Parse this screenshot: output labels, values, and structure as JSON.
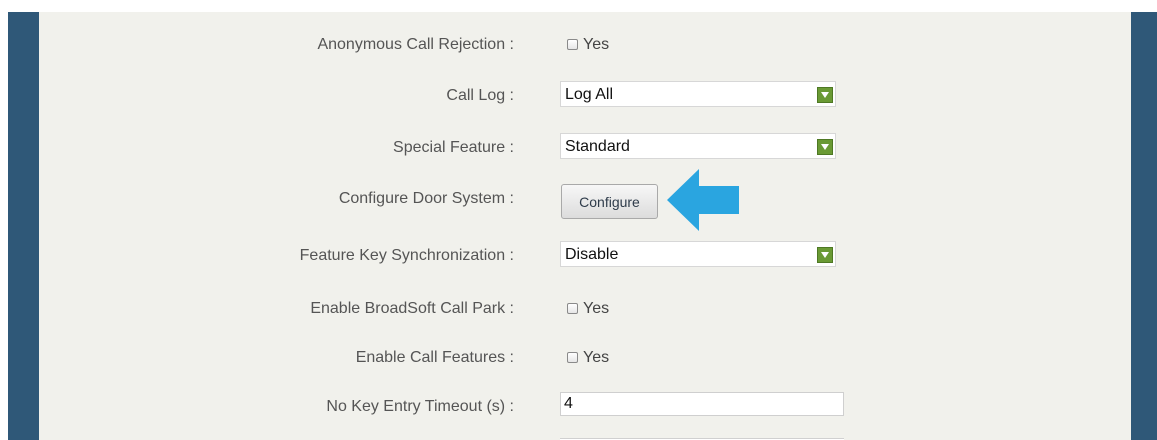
{
  "rows": {
    "anonymous": {
      "label": "Anonymous Call Rejection :",
      "checkbox_label": "Yes",
      "checked": false
    },
    "call_log": {
      "label": "Call Log :",
      "value": "Log All"
    },
    "special_feature": {
      "label": "Special Feature :",
      "value": "Standard"
    },
    "door_system": {
      "label": "Configure Door System :",
      "button_label": "Configure"
    },
    "feature_key_sync": {
      "label": "Feature Key Synchronization :",
      "value": "Disable"
    },
    "broadsoft_call_park": {
      "label": "Enable BroadSoft Call Park :",
      "checkbox_label": "Yes",
      "checked": false
    },
    "call_features": {
      "label": "Enable Call Features :",
      "checkbox_label": "Yes",
      "checked": false
    },
    "no_key_timeout": {
      "label": "No Key Entry Timeout (s) :",
      "value": "4"
    }
  },
  "icons": {
    "dropdown": "triangle-down-icon",
    "highlight_arrow": "left-arrow-icon"
  },
  "colors": {
    "sidebar": "#2f5878",
    "panel": "#f1f1ec",
    "dropdown_button": "#6a9a34",
    "arrow": "#2aa5e0"
  }
}
